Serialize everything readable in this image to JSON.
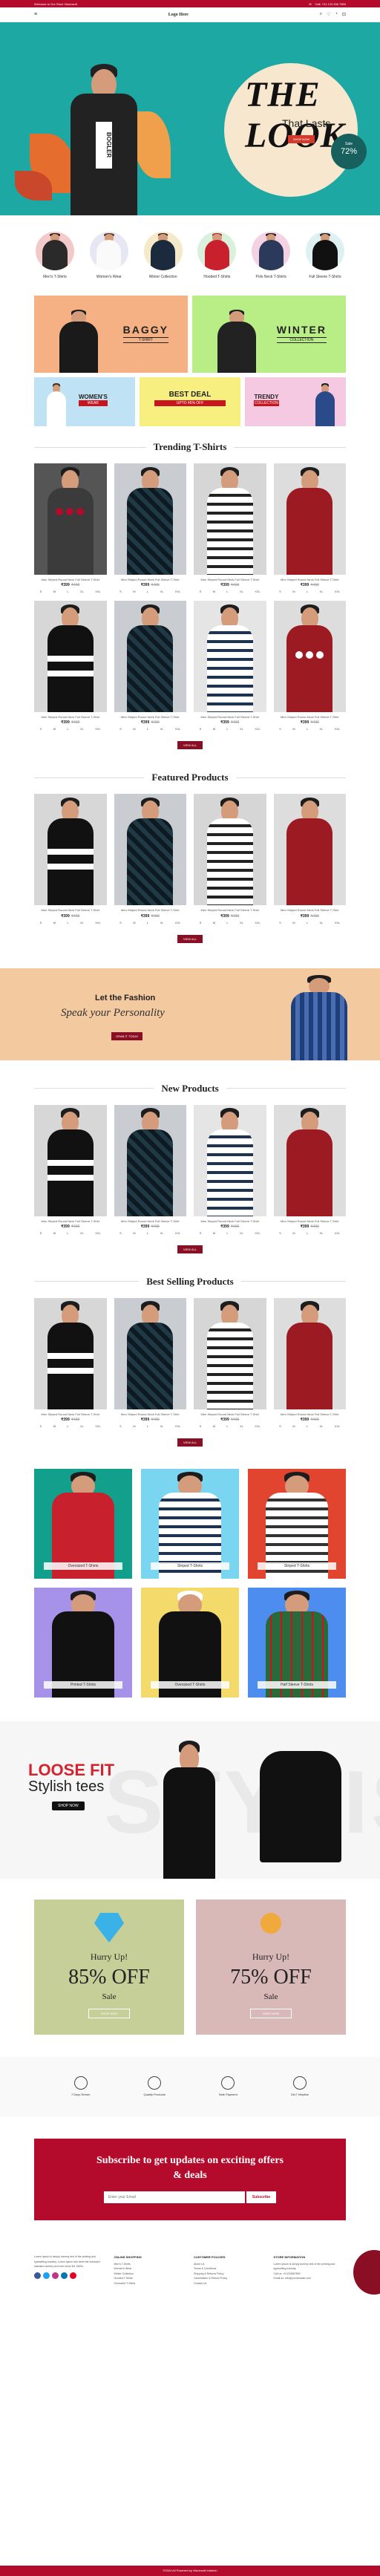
{
  "topbar": {
    "welcome": "Welcome to Our Store Visionsoft",
    "phone": "Call: +01 123 456 7890"
  },
  "header": {
    "logo": "Logo Here"
  },
  "hero": {
    "title": "THE LOOK",
    "subtitle": "That Lasts",
    "button": "SHOP NOW",
    "sale_top": "Sale",
    "sale_value": "72%"
  },
  "categories": [
    {
      "label": "Men's T-Shirts",
      "color": "#f4c9c9"
    },
    {
      "label": "Women's Wear",
      "color": "#e7e7f3"
    },
    {
      "label": "Winter Collection",
      "color": "#f4e9c9"
    },
    {
      "label": "Hooded T-Shirts",
      "color": "#d9f0dc"
    },
    {
      "label": "Polo Neck T-Shirts",
      "color": "#f3d2e3"
    },
    {
      "label": "Full Sleeve T-Shirts",
      "color": "#dff0f2"
    }
  ],
  "banners": {
    "baggy": "BAGGY",
    "baggy_sub": "T-SHIRT",
    "winter": "WINTER",
    "winter_sub": "COLLECTION",
    "women": "WOMEN'S",
    "women_sub": "WEAR",
    "deal": "BEST DEAL",
    "deal_sub": "UPTO 45% OFF",
    "trendy": "TRENDY",
    "trendy_sub": "COLLECTION"
  },
  "sections": {
    "trending": "Trending T-Shirts",
    "featured": "Featured Products",
    "new": "New Products",
    "best": "Best Selling Products",
    "view_all": "VIEW ALL"
  },
  "product": {
    "name": "Men Striped Round Neck Full Sleeve T-Shirt",
    "price": "₹399",
    "old_price": "₹499",
    "sizes": [
      "S",
      "M",
      "L",
      "XL",
      "XXL"
    ]
  },
  "fashion": {
    "title": "Let the Fashion",
    "script": "Speak your Personality",
    "button": "GRAB IT TODAY"
  },
  "tiles": [
    "Oversized T-Shirts",
    "Striped T-Shirts",
    "Striped T-Shirts",
    "Printed T-Shirts",
    "Oversized T-Shirts",
    "Half Sleeve T-Shirts"
  ],
  "loose": {
    "t1": "LOOSE FIT",
    "t2": "Stylish tees",
    "button": "SHOP NOW",
    "bg": "STYLISH"
  },
  "offers": [
    {
      "hurry": "Hurry Up!",
      "pct": "85% OFF",
      "sale": "Sale",
      "button": "SHOP NOW",
      "color": "#c7cf99"
    },
    {
      "hurry": "Hurry Up!",
      "pct": "75% OFF",
      "sale": "Sale",
      "button": "SHOP NOW",
      "color": "#d9b8b8"
    }
  ],
  "features": [
    "7 Days Return",
    "Quality Products",
    "Safe Payment",
    "24x7 Helpline"
  ],
  "newsletter": {
    "title1": "Subscribe to get updates on exciting offers",
    "title2": "& deals",
    "placeholder": "Enter your Email",
    "button": "Subscribe"
  },
  "footer": {
    "about": "Lorem Ipsum is simply dummy text of the printing and typesetting industry. Lorem Ipsum has been the industry's standard dummy text ever since the 1500s.",
    "c1_title": "ONLINE SHOPPING",
    "c1": [
      "Men's T-Shirts",
      "Women's Wear",
      "Winter Collection",
      "Hooded T-Shirts",
      "Oversized T-Shirts"
    ],
    "c2_title": "CUSTOMER POLICIES",
    "c2": [
      "About Us",
      "Terms & Conditions",
      "Shipping & Returns Policy",
      "Cancellation & Refund Policy",
      "Contact Us"
    ],
    "c3_title": "STORE INFORMATION",
    "c3": [
      "Lorem Ipsum is simply dummy text of the printing and typesetting industry.",
      "Call us: +01234567890",
      "Email us: info@yourdomain.com"
    ]
  },
  "copyright": "©2024 All Powered by Visionsoft Infotech"
}
